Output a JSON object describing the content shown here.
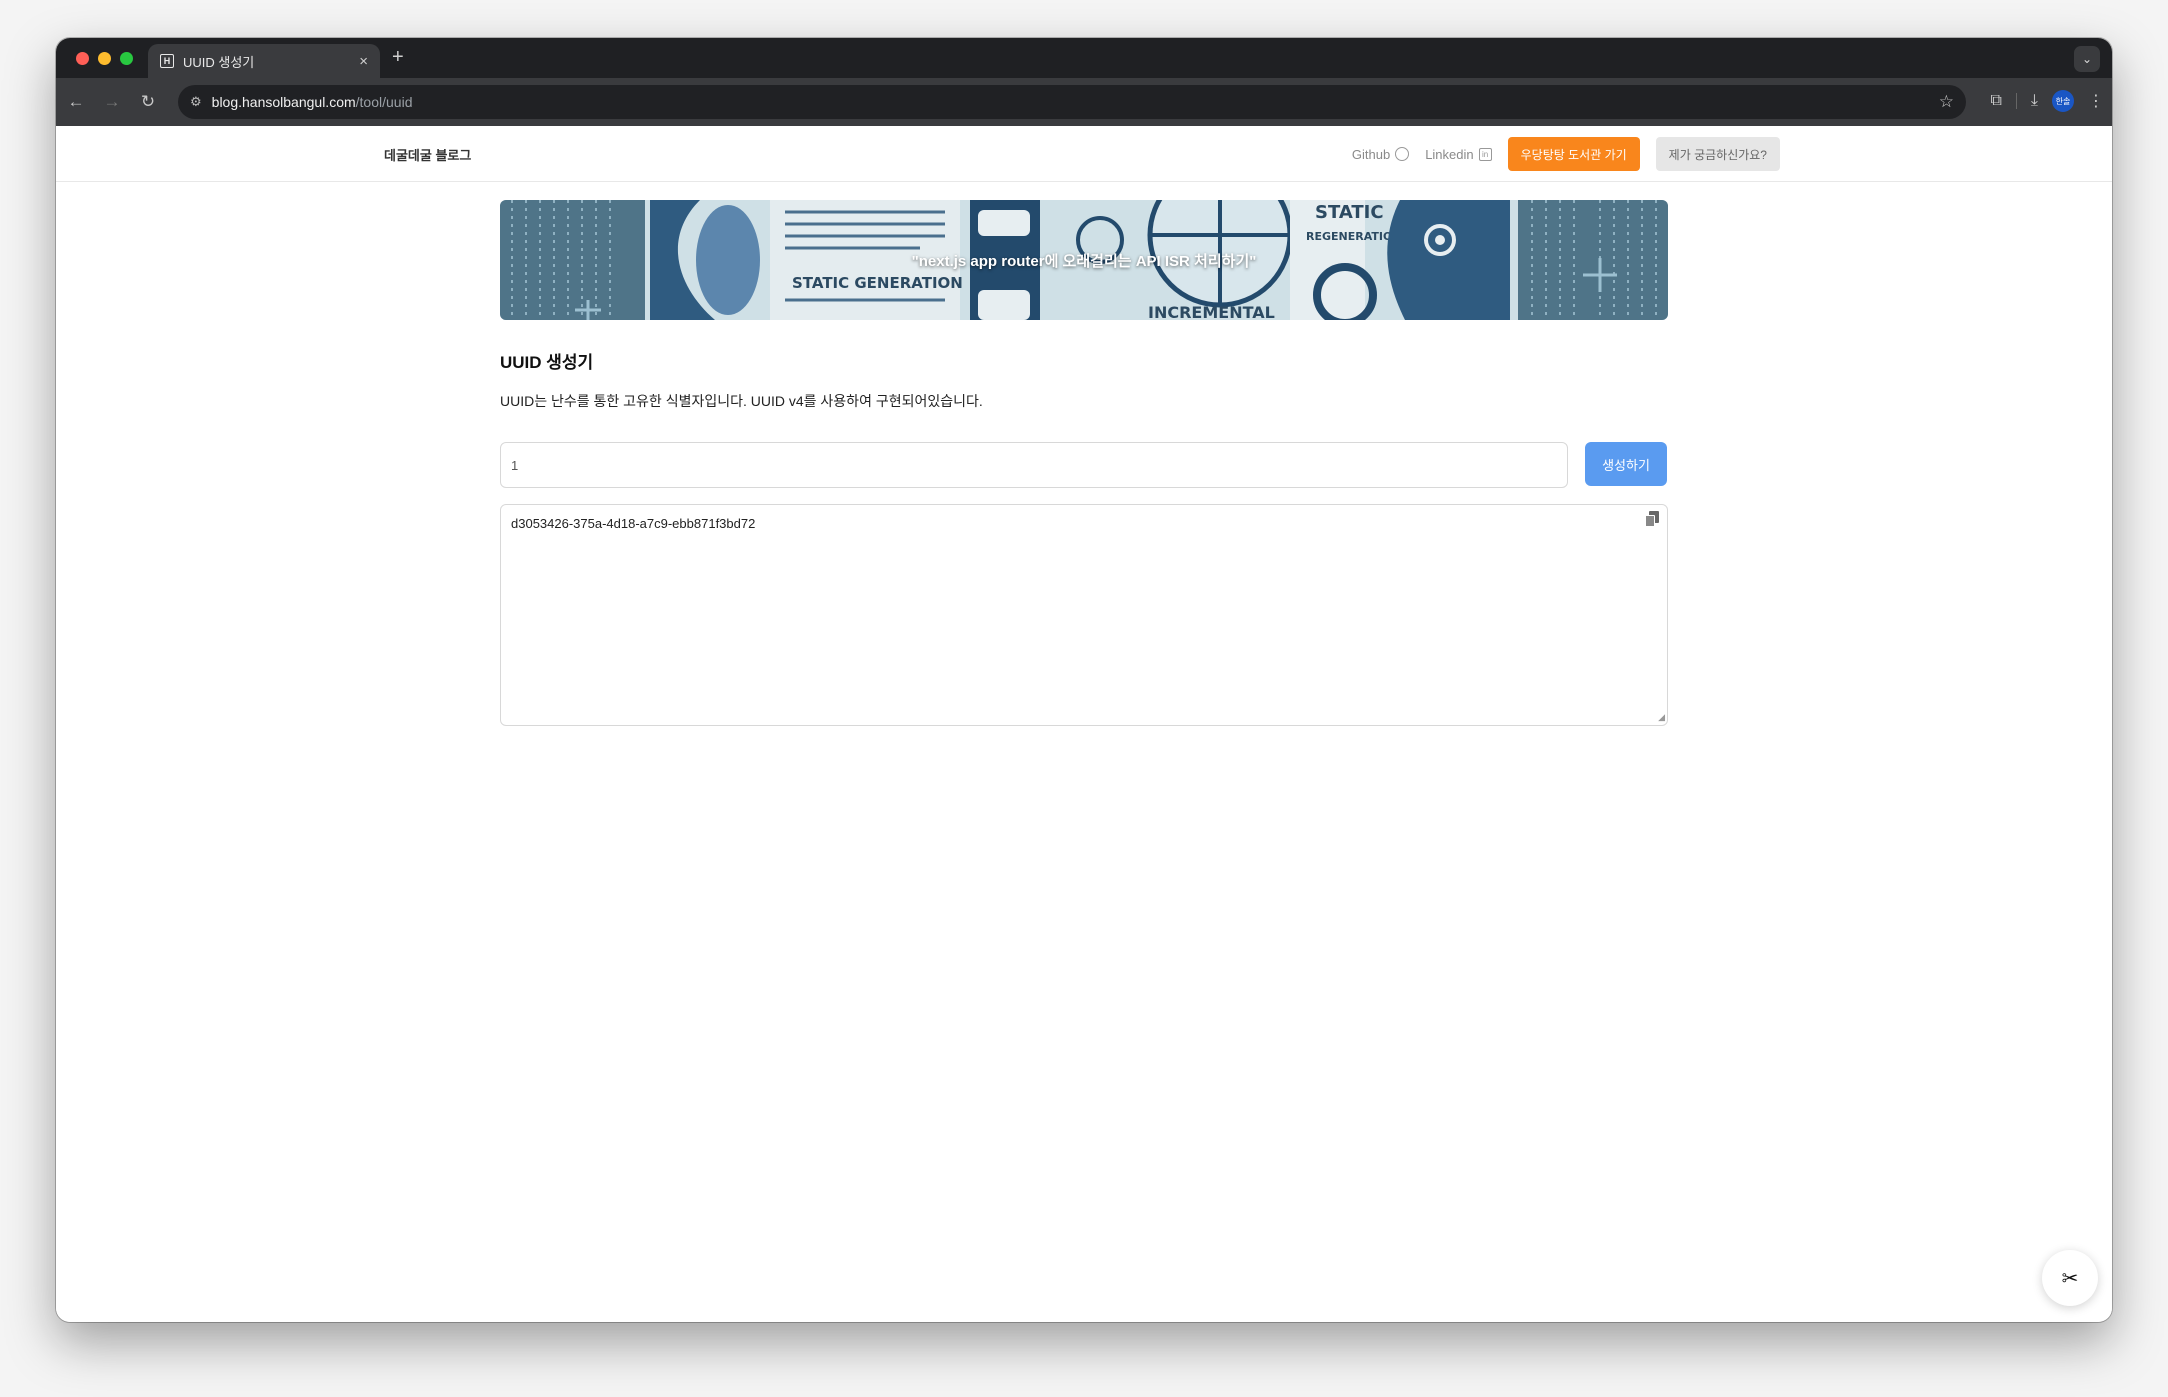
{
  "browser": {
    "tab_title": "UUID 생성기",
    "tab_favicon": "H",
    "url_host": "blog.hansolbangul.com",
    "url_path": "/tool/uuid",
    "profile_label": "한솔"
  },
  "header": {
    "brand": "데굴데굴 블로그",
    "github_label": "Github",
    "linkedin_label": "Linkedin",
    "library_button": "우당탕탕 도서관 가기",
    "question_button": "제가 궁금하신가요?"
  },
  "banner": {
    "caption": "\"next.js app router에 오래걸리는 API ISR 처리하기\"",
    "art_text_1": "STATIC GENERATION",
    "art_text_2": "STATIC",
    "art_text_3": "REGENERATION",
    "art_text_4": "INCREMENTAL"
  },
  "tool": {
    "title": "UUID 생성기",
    "description": "UUID는 난수를 통한 고유한 식별자입니다. UUID v4를 사용하여 구현되어있습니다.",
    "count_value": "1",
    "generate_button": "생성하기",
    "result": "d3053426-375a-4d18-a7c9-ebb871f3bd72"
  },
  "colors": {
    "accent_orange": "#f9861c",
    "generate_blue": "#5a9bf0"
  },
  "icons": [
    "back-icon",
    "forward-icon",
    "reload-icon",
    "star-icon",
    "extensions-icon",
    "download-icon",
    "menu-icon",
    "github-icon",
    "linkedin-icon",
    "copy-icon",
    "tools-icon"
  ]
}
